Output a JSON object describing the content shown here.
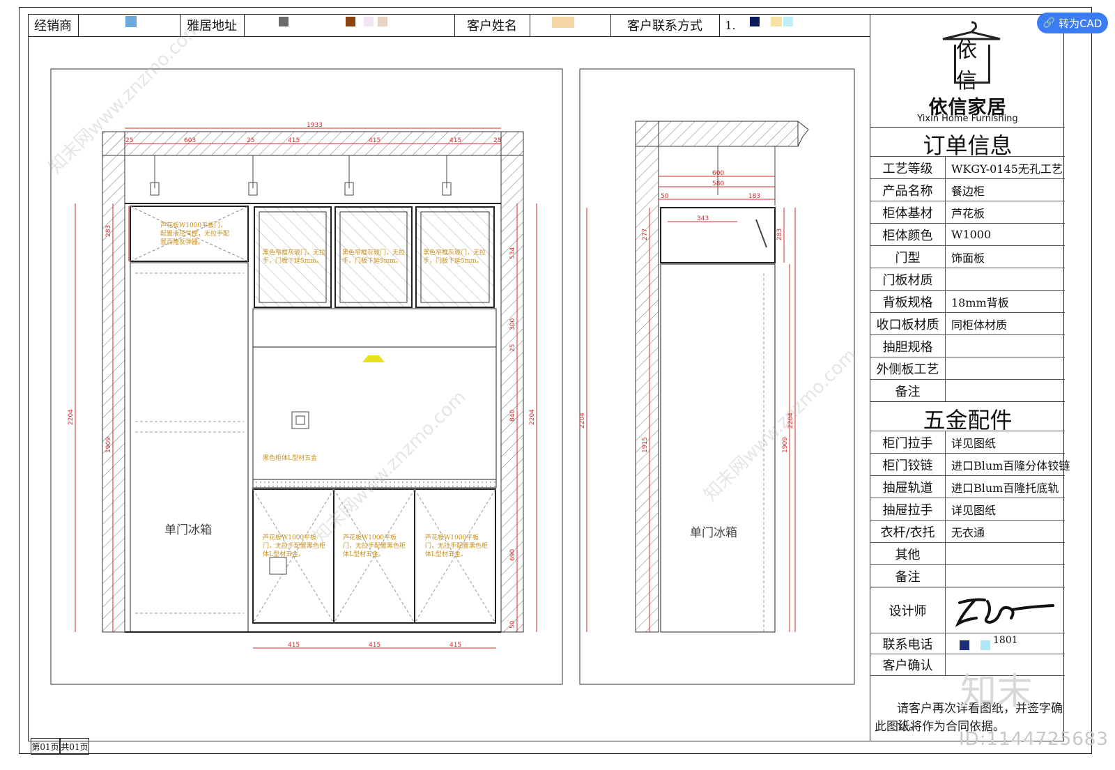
{
  "header": {
    "dealer_label": "经销商",
    "address_label": "雅居地址",
    "customer_name_label": "客户姓名",
    "customer_contact_label": "客户联系方式",
    "contact_value_prefix": "1."
  },
  "toolbar": {
    "convert_cad_label": "转为CAD"
  },
  "brand": {
    "name_cn": "依信家居",
    "name_en": "Yixin Home Furnishing",
    "logo_chars": "依信"
  },
  "order_info": {
    "title": "订单信息",
    "rows": [
      {
        "label": "工艺等级",
        "value": "WKGY-0145无孔工艺"
      },
      {
        "label": "产品名称",
        "value": "餐边柜"
      },
      {
        "label": "柜体基材",
        "value": "芦花板"
      },
      {
        "label": "柜体颜色",
        "value": "W1000"
      },
      {
        "label": "门型",
        "value": "饰面板"
      },
      {
        "label": "门板材质",
        "value": ""
      },
      {
        "label": "背板规格",
        "value": "18mm背板"
      },
      {
        "label": "收口板材质",
        "value": "同柜体材质"
      },
      {
        "label": "抽胆规格",
        "value": ""
      },
      {
        "label": "外侧板工艺",
        "value": ""
      },
      {
        "label": "备注",
        "value": ""
      }
    ]
  },
  "hardware": {
    "title": "五金配件",
    "rows": [
      {
        "label": "柜门拉手",
        "value": "详见图纸"
      },
      {
        "label": "柜门铰链",
        "value": "进口Blum百隆分体铰链"
      },
      {
        "label": "抽屉轨道",
        "value": "进口Blum百隆托底轨"
      },
      {
        "label": "抽屉拉手",
        "value": "详见图纸"
      },
      {
        "label": "衣杆/衣托",
        "value": "无衣通"
      },
      {
        "label": "其他",
        "value": ""
      },
      {
        "label": "备注",
        "value": ""
      }
    ]
  },
  "signoff": {
    "designer_label": "设计师",
    "phone_label": "联系电话",
    "phone_value": "1801",
    "customer_confirm_label": "客户确认",
    "notice_line1": "请客户再次详看图纸，并签字确认。",
    "notice_line2": "此图纸将作为合同依据。"
  },
  "pager": {
    "page_label": "第01页",
    "total_label": "共01页"
  },
  "watermark": {
    "id_text": "ID:1144725683",
    "site_text": "知末网www.znzmo.com",
    "corner_text": "知末"
  },
  "front_view": {
    "overall_width": "1933",
    "top_dims": [
      "25",
      "603",
      "25",
      "415",
      "415",
      "415",
      "25"
    ],
    "bottom_dims": [
      "415",
      "415",
      "415"
    ],
    "left_heights": [
      "2204",
      "1909",
      "283"
    ],
    "right_heights": [
      "534",
      "300",
      "25",
      "840",
      "690",
      "50",
      "2204"
    ],
    "fridge_label": "单门冰箱",
    "note_top_left": "芦花板W1000平板门，配置液压气撑，无拉手配置百隆反弹器。",
    "note_glass": "黑色窄框灰玻门，无拉手，门板下延5mm。",
    "note_lprofile": "黑色柜体L型材五金",
    "note_bottom": "芦花板W1000平板门，无拉手配置黑色柜体L型材五金。"
  },
  "side_view": {
    "dims": [
      "600",
      "580",
      "50",
      "183",
      "343"
    ],
    "heights": [
      "2204",
      "1915",
      "277",
      "283",
      "1909",
      "2204"
    ],
    "fridge_label": "单门冰箱"
  },
  "colors": {
    "dimension_red": "#d42a2a",
    "note_gold": "#c8911c",
    "cad_button": "#3b7cf5",
    "hatch": "#555555",
    "swatches": [
      "#6fa8dc",
      "#6b6b6b",
      "#8b4513",
      "#e8d2c2",
      "#f6d8a8",
      "#0b1a5c",
      "#f7e2a6",
      "#bdf0f7",
      "#1d2d7a",
      "#aee6f5"
    ]
  }
}
